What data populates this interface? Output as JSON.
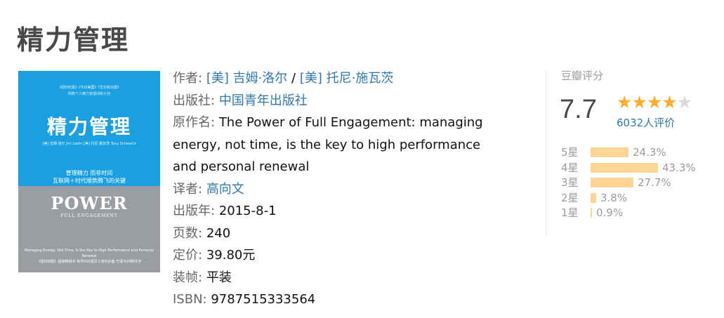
{
  "book": {
    "title": "精力管理"
  },
  "cover": {
    "top_line_1": "《纽约时报》《今日美国》《华尔街日报》",
    "top_line_2": "附赠个人精力管理训练计划",
    "title": "精力管理",
    "authors_line": "[美] 吉姆·洛尔  Jim Loehr    [美] 托尼·施瓦茨  Tony Schwartz",
    "slogan_1": "管理精力  而非时间",
    "slogan_2": "互联网＋时代顺势腾飞的关键",
    "english_title": "POWER",
    "english_subtitle": "FULL ENGAGEMENT",
    "bottom_line_1": "Managing Energy, Not Time, Is the Key to High Performance and Personal Renewal",
    "bottom_line_2": "《纽约时报》超级畅销书  世界500强员工培训必备  已译为28种文字",
    "top_color": "#1aa0e0",
    "bottom_color": "#9a9ea3"
  },
  "info": {
    "author_label": "作者:",
    "author_1": "[美] 吉姆·洛尔",
    "author_sep": " / ",
    "author_2": "[美] 托尼·施瓦茨",
    "publisher_label": "出版社:",
    "publisher": "中国青年出版社",
    "original_title_label": "原作名:",
    "original_title": "The Power of Full Engagement: managing energy, not time, is the key to high performance and personal renewal",
    "translator_label": "译者:",
    "translator": "高向文",
    "pub_year_label": "出版年:",
    "pub_year": "2015-8-1",
    "pages_label": "页数:",
    "pages": "240",
    "price_label": "定价:",
    "price": "39.80元",
    "binding_label": "装帧:",
    "binding": "平装",
    "isbn_label": "ISBN:",
    "isbn": "9787515333564"
  },
  "rating": {
    "label": "豆瓣评分",
    "score": "7.7",
    "stars_filled": 4,
    "stars_total": 5,
    "votes": "6032人评价",
    "distribution": [
      {
        "label": "5星",
        "percent_text": "24.3%",
        "percent": 24.3
      },
      {
        "label": "4星",
        "percent_text": "43.3%",
        "percent": 43.3
      },
      {
        "label": "3星",
        "percent_text": "27.7%",
        "percent": 27.7
      },
      {
        "label": "2星",
        "percent_text": "3.8%",
        "percent": 3.8
      },
      {
        "label": "1星",
        "percent_text": "0.9%",
        "percent": 0.9
      }
    ],
    "star_color": "#ffac2d",
    "bar_color": "#ffd596",
    "link_color": "#3377aa"
  }
}
